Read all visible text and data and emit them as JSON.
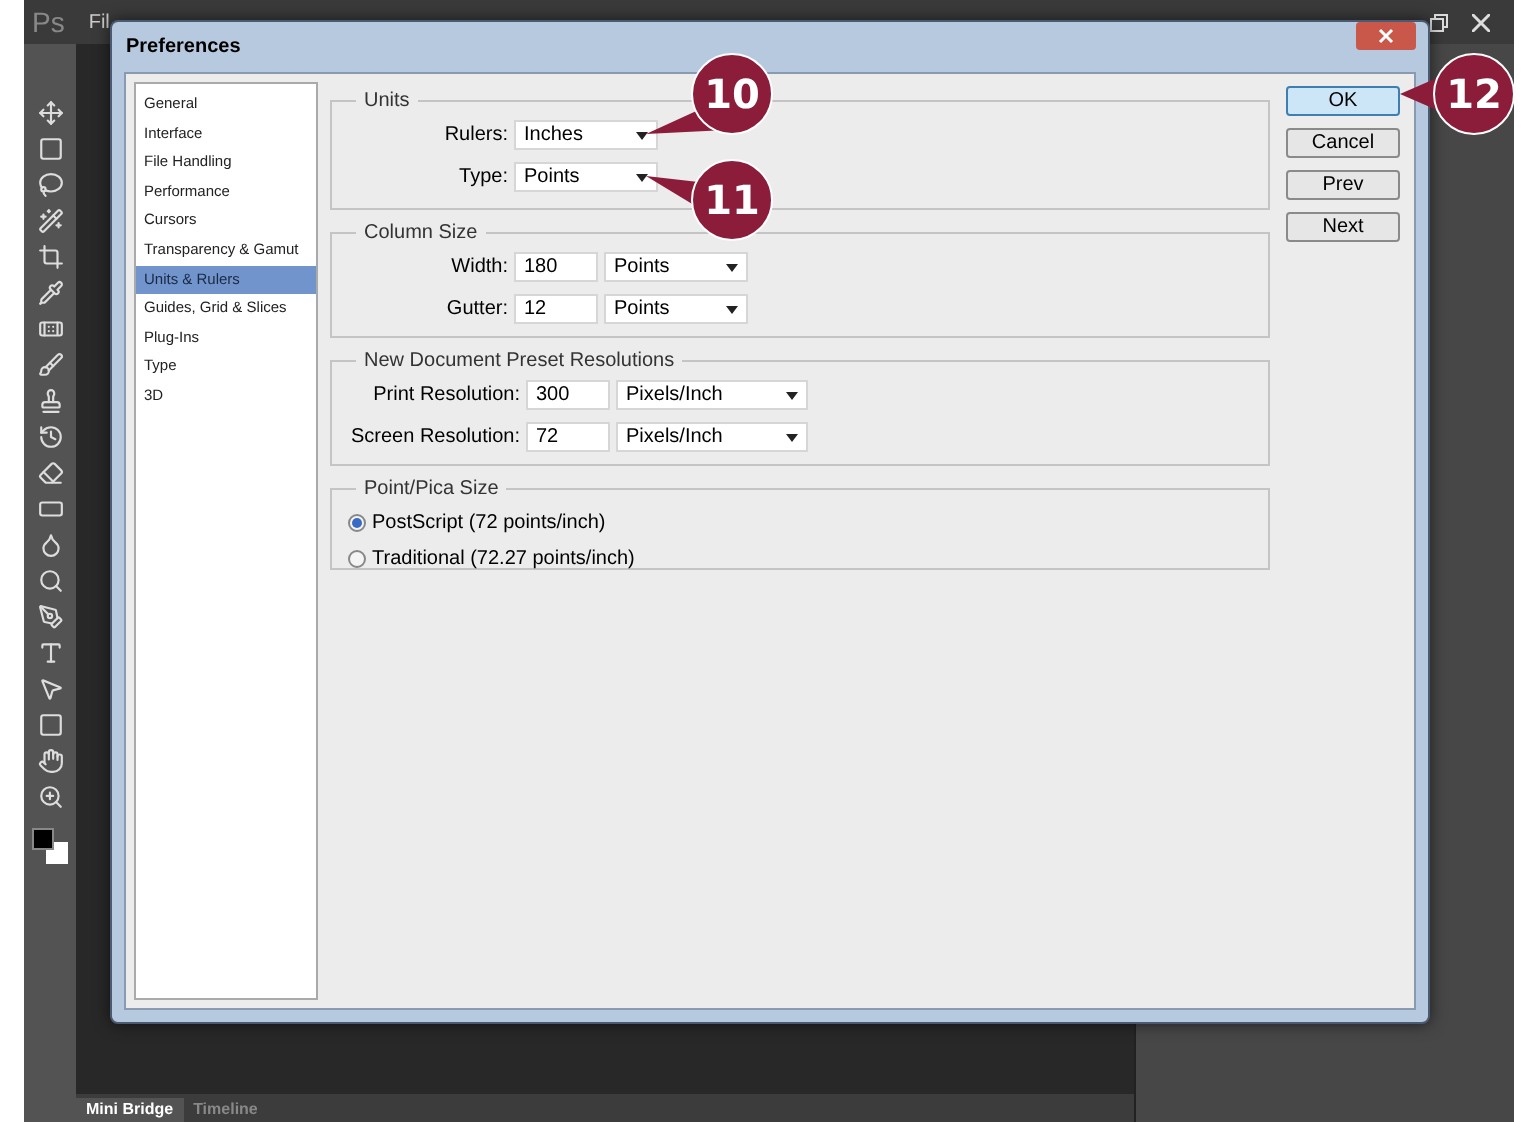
{
  "app": {
    "logo": "Ps",
    "menu": [
      "Fil"
    ],
    "panel_tabs": [
      {
        "label": "Mini Bridge",
        "selected": true
      },
      {
        "label": "Timeline",
        "selected": false
      }
    ]
  },
  "dialog": {
    "title": "Preferences",
    "sidebar": [
      {
        "label": "General",
        "selected": false
      },
      {
        "label": "Interface",
        "selected": false
      },
      {
        "label": "File Handling",
        "selected": false
      },
      {
        "label": "Performance",
        "selected": false
      },
      {
        "label": "Cursors",
        "selected": false
      },
      {
        "label": "Transparency & Gamut",
        "selected": false
      },
      {
        "label": "Units & Rulers",
        "selected": true
      },
      {
        "label": "Guides, Grid & Slices",
        "selected": false
      },
      {
        "label": "Plug-Ins",
        "selected": false
      },
      {
        "label": "Type",
        "selected": false
      },
      {
        "label": "3D",
        "selected": false
      }
    ],
    "units": {
      "title": "Units",
      "fields": [
        {
          "label": "Rulers:",
          "value": "Inches"
        },
        {
          "label": "Type:",
          "value": "Points"
        }
      ]
    },
    "column_size": {
      "title": "Column Size",
      "fields": [
        {
          "label": "Width:",
          "value": "180",
          "unit": "Points"
        },
        {
          "label": "Gutter:",
          "value": "12",
          "unit": "Points"
        }
      ]
    },
    "resolutions": {
      "title": "New Document Preset Resolutions",
      "fields": [
        {
          "label": "Print Resolution:",
          "value": "300",
          "unit": "Pixels/Inch"
        },
        {
          "label": "Screen Resolution:",
          "value": "72",
          "unit": "Pixels/Inch"
        }
      ]
    },
    "point_pica": {
      "title": "Point/Pica Size",
      "options": [
        {
          "label": "PostScript (72 points/inch)",
          "selected": true
        },
        {
          "label": "Traditional (72.27 points/inch)",
          "selected": false
        }
      ]
    },
    "buttons": [
      {
        "label": "OK",
        "default": true
      },
      {
        "label": "Cancel",
        "default": false
      },
      {
        "label": "Prev",
        "default": false
      },
      {
        "label": "Next",
        "default": false
      }
    ]
  },
  "callouts": [
    {
      "number": "10"
    },
    {
      "number": "11"
    },
    {
      "number": "12"
    }
  ]
}
